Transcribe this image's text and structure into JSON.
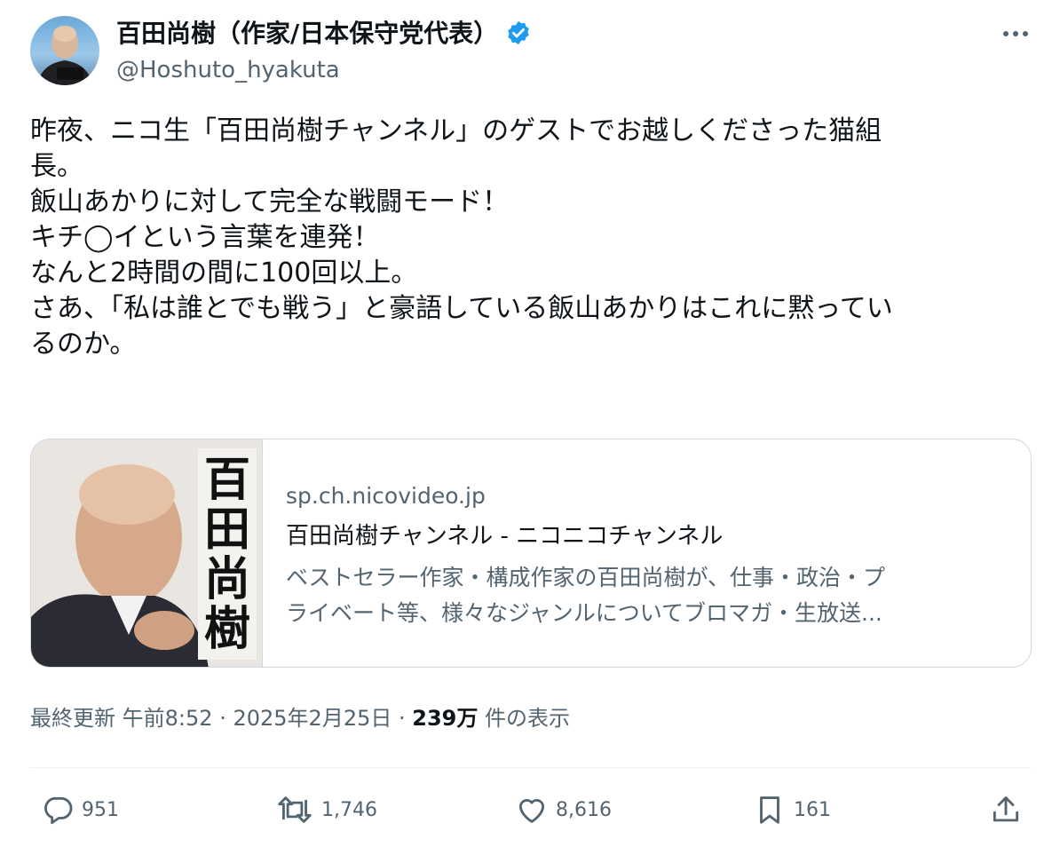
{
  "author": {
    "display_name": "百田尚樹（作家/日本保守党代表）",
    "handle": "@Hoshuto_hyakuta",
    "avatar_caption": "百田尚樹",
    "verified_color": "#1d9bf0"
  },
  "tweet": {
    "lines": [
      "昨夜、ニコ生「百田尚樹チャンネル」のゲストでお越しくださった猫組",
      "長。",
      "飯山あかりに対して完全な戦闘モード！",
      "キチ◯イという言葉を連発！",
      "なんと2時間の間に100回以上。",
      "さあ、「私は誰とでも戦う」と豪語している飯山あかりはこれに黙ってい",
      "るのか。"
    ]
  },
  "card": {
    "thumb_text": [
      "百",
      "田",
      "尚",
      "樹"
    ],
    "domain": "sp.ch.nicovideo.jp",
    "title": "百田尚樹チャンネル - ニコニコチャンネル",
    "description_lines": [
      "ベストセラー作家・構成作家の百田尚樹が、仕事・政治・プ",
      "ライベート等、様々なジャンルについてブロマガ・生放送..."
    ]
  },
  "meta": {
    "updated_label": "最終更新",
    "time": "午前8:52",
    "sep1": "·",
    "date": "2025年2月25日",
    "sep2": "·",
    "views": "239万",
    "views_label": "件の表示"
  },
  "actions": {
    "replies": "951",
    "reposts": "1,746",
    "likes": "8,616",
    "bookmarks": "161"
  }
}
